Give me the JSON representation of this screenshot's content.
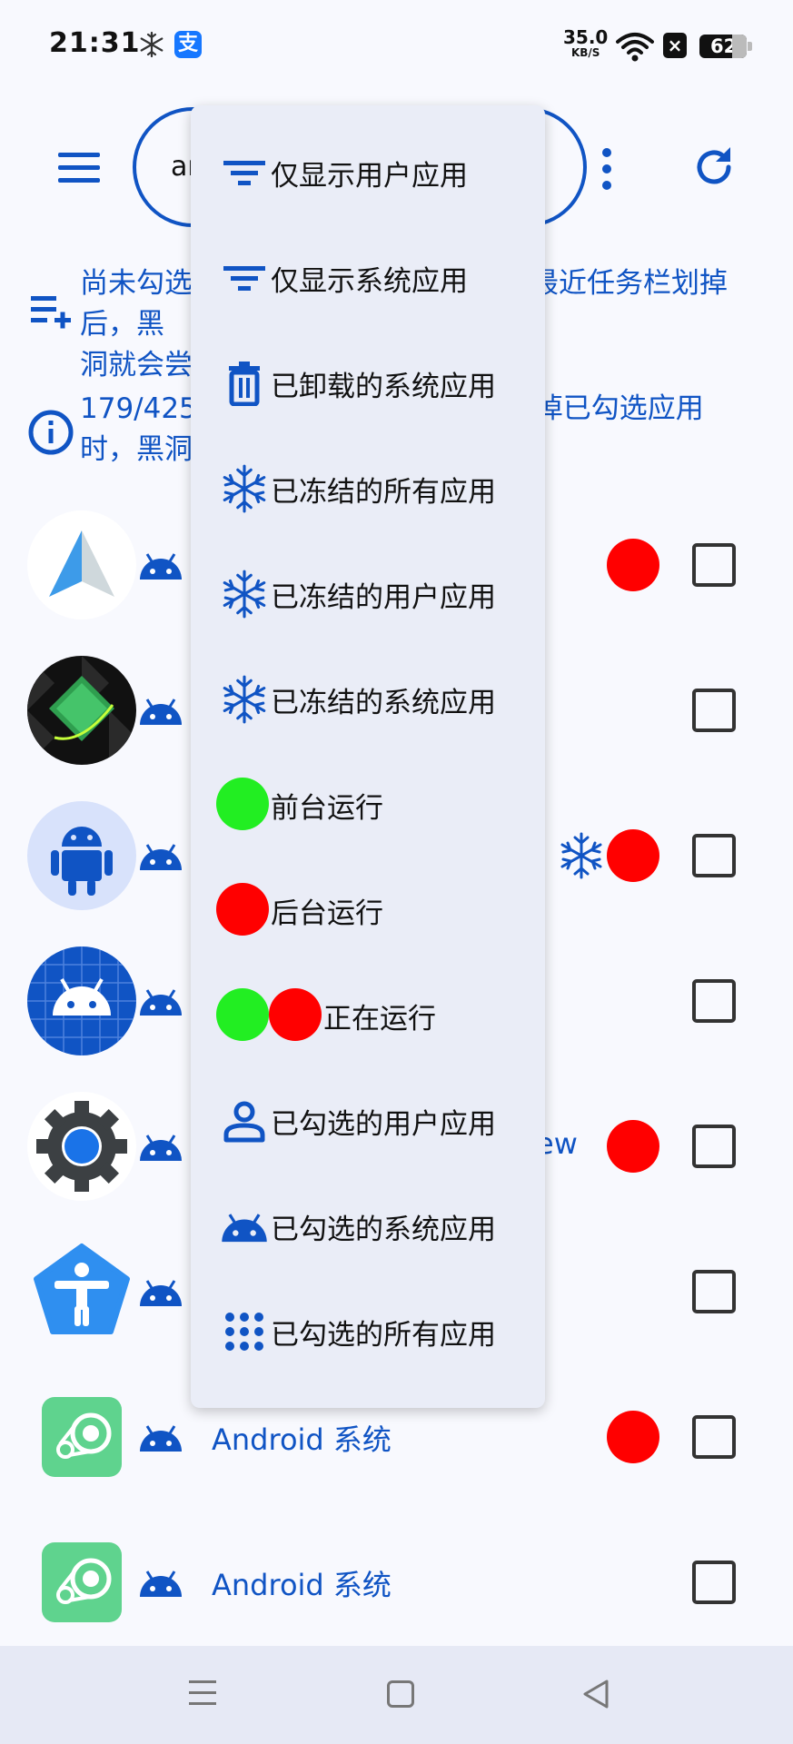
{
  "status_bar": {
    "time": "21:31",
    "alipay_glyph": "支",
    "net_speed_value": "35.0",
    "net_speed_unit": "KB/S",
    "close_glyph": "×",
    "battery_level": "62",
    "icons": [
      "snowflake-icon",
      "alipay-icon",
      "wifi-icon",
      "close-notification-icon",
      "battery-icon"
    ]
  },
  "toolbar": {
    "search_value": "ar",
    "icons": [
      "hamburger-menu-icon",
      "more-vertical-icon",
      "refresh-icon"
    ]
  },
  "info_banner_1": {
    "line1": "尚未勾选任何应用，勾选的应用在从最近任务栏划掉后，黑",
    "line2": "洞就会尝试冻结它们",
    "icon": "playlist-add-icon"
  },
  "info_banner_2": {
    "line1": "179/425个应用，在从最近任务栏划掉已勾选应用",
    "line2": "时，黑洞会尝试冻结它们",
    "icon": "info-icon"
  },
  "app_list": [
    {
      "label": "",
      "running_background": true,
      "frozen": false,
      "icon": "android-auto-icon"
    },
    {
      "label": "",
      "running_background": false,
      "frozen": false,
      "icon": "green-app-icon"
    },
    {
      "label": "",
      "running_background": true,
      "frozen": true,
      "icon": "android-robot-icon"
    },
    {
      "label": "",
      "running_background": false,
      "frozen": false,
      "icon": "android-blueprint-icon"
    },
    {
      "label": "ew",
      "running_background": true,
      "frozen": false,
      "icon": "settings-gear-icon"
    },
    {
      "label": "",
      "running_background": false,
      "frozen": false,
      "icon": "accessibility-icon"
    },
    {
      "label": "Android 系统",
      "running_background": true,
      "frozen": false,
      "icon": "android-system-icon"
    },
    {
      "label": "Android 系统",
      "running_background": false,
      "frozen": false,
      "icon": "android-system-icon"
    }
  ],
  "dropdown_menu": {
    "items": [
      {
        "label": "仅显示用户应用",
        "icon": "filter-icon"
      },
      {
        "label": "仅显示系统应用",
        "icon": "filter-icon"
      },
      {
        "label": "已卸载的系统应用",
        "icon": "trash-icon"
      },
      {
        "label": "已冻结的所有应用",
        "icon": "snowflake-icon"
      },
      {
        "label": "已冻结的用户应用",
        "icon": "snowflake-icon"
      },
      {
        "label": "已冻结的系统应用",
        "icon": "snowflake-icon"
      },
      {
        "label": "前台运行",
        "icon": "green-dot-icon"
      },
      {
        "label": "后台运行",
        "icon": "red-dot-icon"
      },
      {
        "label": "正在运行",
        "icon": "green-red-dots-icon"
      },
      {
        "label": "已勾选的用户应用",
        "icon": "person-icon"
      },
      {
        "label": "已勾选的系统应用",
        "icon": "android-head-icon"
      },
      {
        "label": "已勾选的所有应用",
        "icon": "grid-dots-icon"
      }
    ]
  },
  "nav_bar": {
    "icons": [
      "nav-menu-icon",
      "nav-home-icon",
      "nav-back-icon"
    ]
  },
  "colors": {
    "accent_blue": "#1054c4",
    "running_red": "#ff0000",
    "foreground_green": "#22ee22",
    "menu_bg": "#eaedf7",
    "page_bg": "#f8f9fe"
  }
}
